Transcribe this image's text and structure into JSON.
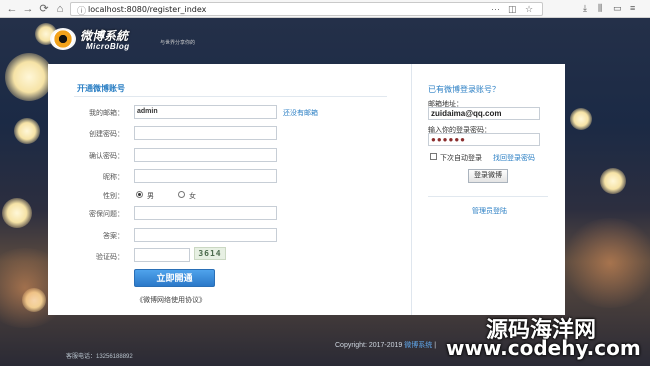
{
  "browser": {
    "url": "localhost:8080/register_index"
  },
  "logo": {
    "title": "微博系統",
    "subtitle": "MicroBlog",
    "tagline": "与世界分享你的"
  },
  "register": {
    "title": "开通微博账号",
    "email_label": "我的邮箱：",
    "email_value": "admin",
    "no_email_link": "还没有邮箱",
    "password_label": "创建密码：",
    "confirm_label": "确认密码：",
    "nickname_label": "昵称：",
    "gender_label": "性别：",
    "gender_male": "男",
    "gender_female": "女",
    "question_label": "密保问题：",
    "answer_label": "答案：",
    "captcha_label": "验证码：",
    "captcha_text": "3614",
    "submit_label": "立即開通",
    "agreement_link": "《微博网络使用协议》"
  },
  "login": {
    "title": "已有微博登录账号？",
    "email_label": "邮箱地址：",
    "email_value": "zuidaima@qq.com",
    "password_label": "输入你的登录密码：",
    "password_value": "●●●●●●",
    "remember_label": "下次自动登录",
    "forgot_link": "找回登录密码",
    "login_button": "登录微博",
    "admin_link": "管理员登陆"
  },
  "footer": {
    "copyright": "Copyright: 2017-2019",
    "brand_link": "微博系统",
    "sep": "|",
    "hotline": "客服电话：13256188892"
  },
  "watermark": {
    "title": "源码海洋网",
    "url": "www.codehy.com"
  }
}
